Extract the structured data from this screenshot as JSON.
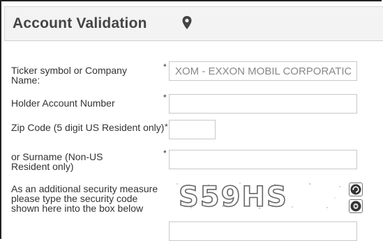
{
  "header": {
    "title": "Account Validation",
    "icon": "map-pin-icon"
  },
  "form": {
    "ticker": {
      "label": "Ticker symbol or Company Name:",
      "required": "*",
      "value": "XOM - EXXON MOBIL CORPORATIC"
    },
    "holder": {
      "label": "Holder Account Number",
      "required": "*",
      "value": ""
    },
    "zip": {
      "label": "Zip Code (5 digit US Resident only)",
      "required": "*",
      "value": ""
    },
    "surname": {
      "label": "or Surname (Non-US Resident only)",
      "required": "*",
      "value": ""
    },
    "security": {
      "label": "As an additional security measure please type the security code shown here into the box below",
      "captcha_text": "S59HS",
      "value": ""
    }
  }
}
